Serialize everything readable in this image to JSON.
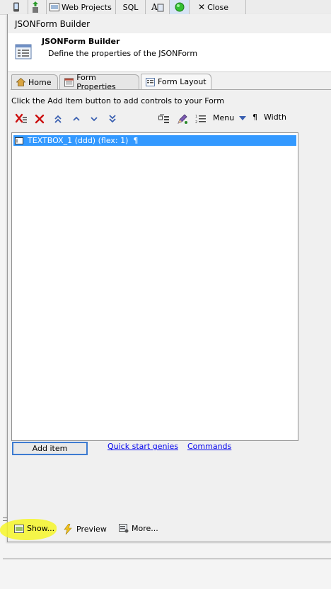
{
  "toolbar": {
    "web_projects_label": "Web Projects",
    "sql_label": "SQL",
    "close_label": "Close"
  },
  "dialog": {
    "window_title": "JSONForm Builder",
    "header_title": "JSONForm Builder",
    "header_description": "Define the properties of the JSONForm"
  },
  "tabs": [
    {
      "label": "Home"
    },
    {
      "label": "Form Properties"
    },
    {
      "label": "Form Layout",
      "active": true
    }
  ],
  "layout": {
    "instruction": "Click the Add Item button to add controls to your Form",
    "menu_label": "Menu",
    "pilcrow": "¶",
    "width_label": "Width",
    "items": [
      {
        "text": "TEXTBOX_1 (ddd) (flex: 1)",
        "mark": "¶",
        "selected": true
      }
    ],
    "add_item_label": "Add item",
    "quick_start_label": "Quick start genies",
    "commands_label": "Commands"
  },
  "footer": {
    "show_label": "Show...",
    "preview_label": "Preview",
    "more_label": "More..."
  },
  "colors": {
    "selection": "#3399ff",
    "link": "#0000ee",
    "delete_red": "#cc1111",
    "arrow_blue": "#3a5fb0",
    "highlight": "#f6f62a"
  }
}
